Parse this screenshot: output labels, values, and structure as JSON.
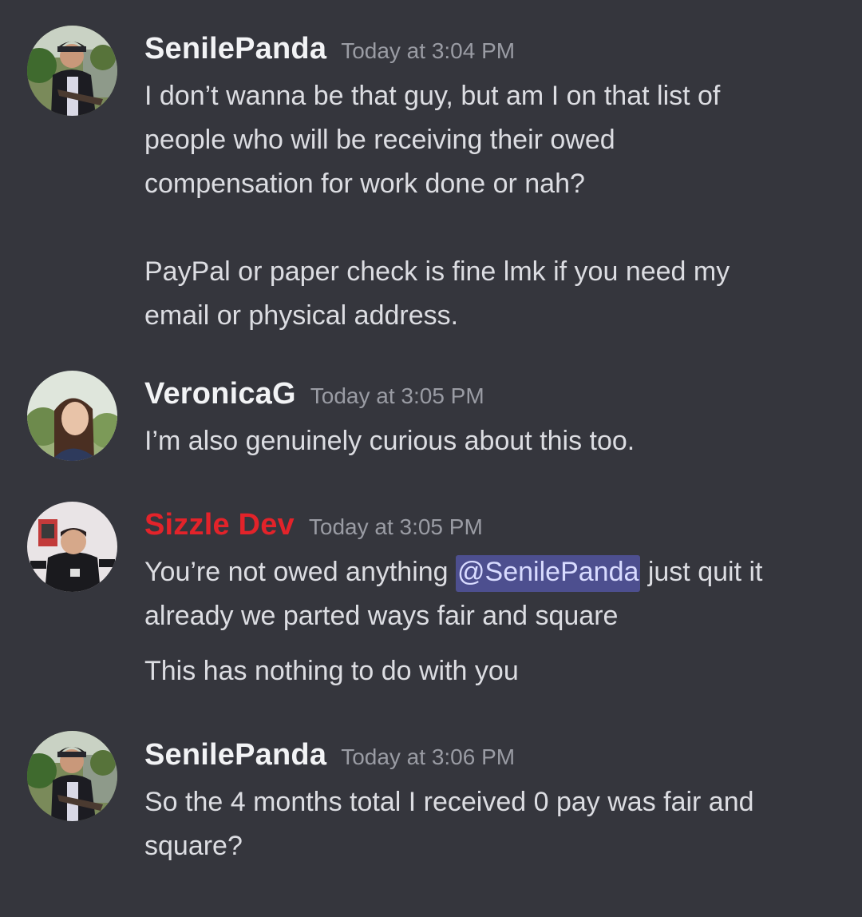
{
  "messages": [
    {
      "author": "SenilePanda",
      "author_color": "#f2f3f5",
      "timestamp": "Today at 3:04 PM",
      "lines": [
        "I don’t wanna be that guy, but am I on that list of",
        "people who will be receiving their owed",
        "compensation for work done or nah?",
        "PayPal or paper check is fine lmk if you need my",
        "email or physical address."
      ]
    },
    {
      "author": "VeronicaG",
      "author_color": "#f2f3f5",
      "timestamp": "Today at 3:05 PM",
      "lines": [
        "I’m also genuinely curious about this too."
      ]
    },
    {
      "author": "Sizzle Dev",
      "author_color": "#e3232a",
      "timestamp": "Today at 3:05 PM",
      "line1_before": "You’re not owed anything ",
      "mention": "@SenilePanda",
      "line1_after": " just quit it",
      "line2": "already we parted ways fair and square",
      "followup": "This has nothing to do with you"
    },
    {
      "author": "SenilePanda",
      "author_color": "#f2f3f5",
      "timestamp": "Today at 3:06 PM",
      "lines": [
        "So the 4 months total I received 0 pay was fair and",
        "square?"
      ]
    }
  ],
  "colors": {
    "background": "#35363d",
    "mention_bg": "#4d4f8f",
    "mention_text": "#d8dbff",
    "timestamp": "#9a9ca4",
    "body_text": "#dcdde2"
  }
}
